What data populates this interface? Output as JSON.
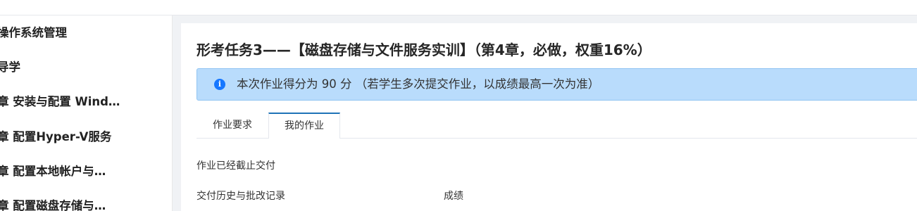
{
  "sidebar": {
    "items": [
      {
        "label": "操作系统管理"
      },
      {
        "label": "导学"
      },
      {
        "label": "章 安装与配置 Wind…"
      },
      {
        "label": "章 配置Hyper-V服务"
      },
      {
        "label": "章 配置本地帐户与…"
      },
      {
        "label": "章 配置磁盘存储与…"
      }
    ]
  },
  "main": {
    "title": "形考任务3——【磁盘存储与文件服务实训】（第4章，必做，权重16%）",
    "alert": {
      "icon": "info-icon",
      "text": "本次作业得分为 90 分 （若学生多次提交作业，以成绩最高一次为准）"
    },
    "tabs": [
      {
        "label": "作业要求"
      },
      {
        "label": "我的作业",
        "active": true
      }
    ],
    "status_text": "作业已经截止交付",
    "history_label": "交付历史与批改记录",
    "grade_label": "成绩"
  },
  "colors": {
    "alert_background": "#b9dcfc",
    "info_icon": "#1677ff",
    "active_tab_border": "#1f73b7",
    "page_gutter": "#f0f2f5"
  }
}
